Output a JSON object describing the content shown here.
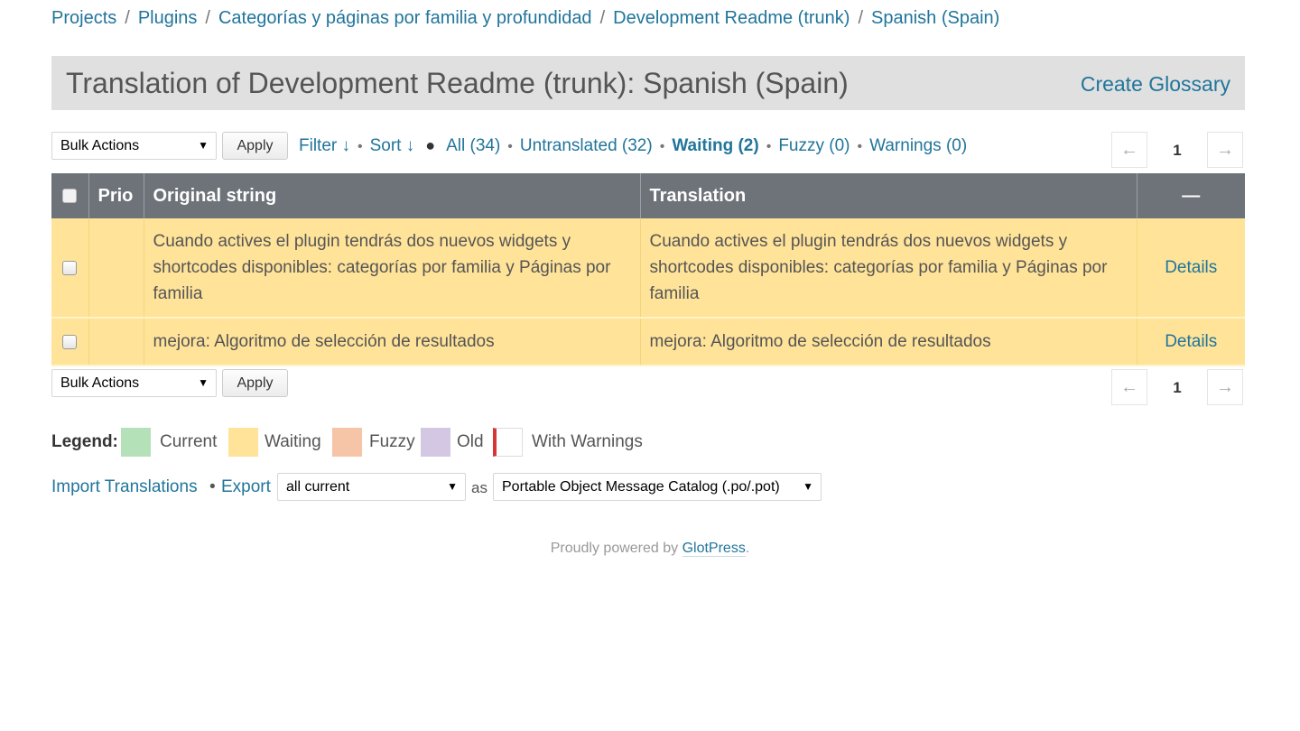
{
  "breadcrumb": {
    "items": [
      "Projects",
      "Plugins",
      "Categorías y páginas por familia y profundidad",
      "Development Readme (trunk)",
      "Spanish (Spain)"
    ],
    "separator": "/"
  },
  "header": {
    "title": "Translation of Development Readme (trunk): Spanish (Spain)",
    "glossary_link": "Create Glossary"
  },
  "toolbar": {
    "bulk_actions": "Bulk Actions",
    "apply": "Apply",
    "filter": "Filter ↓",
    "sort": "Sort ↓",
    "all": "All (34)",
    "untranslated": "Untranslated (32)",
    "waiting": "Waiting (2)",
    "fuzzy": "Fuzzy (0)",
    "warnings": "Warnings (0)"
  },
  "pagination": {
    "prev": "←",
    "page": "1",
    "next": "→"
  },
  "table": {
    "headers": {
      "prio": "Prio",
      "original": "Original string",
      "translation": "Translation",
      "actions": "—"
    },
    "rows": [
      {
        "original": "Cuando actives el plugin tendrás dos nuevos widgets y shortcodes disponibles: categorías por familia y Páginas por familia",
        "translation": "Cuando actives el plugin tendrás dos nuevos widgets y shortcodes disponibles: categorías por familia y Páginas por familia",
        "action": "Details",
        "status": "waiting"
      },
      {
        "original": "mejora: Algoritmo de selección de resultados",
        "translation": "mejora: Algoritmo de selección de resultados",
        "action": "Details",
        "status": "waiting"
      }
    ]
  },
  "legend": {
    "label": "Legend:",
    "items": [
      {
        "label": "Current",
        "color": "#b5e1b9"
      },
      {
        "label": "Waiting",
        "color": "#ffe399"
      },
      {
        "label": "Fuzzy",
        "color": "#f6c5a7"
      },
      {
        "label": "Old",
        "color": "#d3c7e3"
      },
      {
        "label": "With Warnings",
        "color": "#ffffff",
        "accent": "#d63638"
      }
    ]
  },
  "export": {
    "import_link": "Import Translations",
    "bullet": "•",
    "export_link": "Export",
    "what": "all current",
    "as": "as",
    "format": "Portable Object Message Catalog (.po/.pot)"
  },
  "footer": {
    "text": "Proudly powered by ",
    "link": "GlotPress",
    "period": "."
  },
  "colors": {
    "link": "#21759b",
    "header_bg": "#6e7379",
    "waiting_row": "#ffe399",
    "title_bar": "#e0e0e0"
  }
}
